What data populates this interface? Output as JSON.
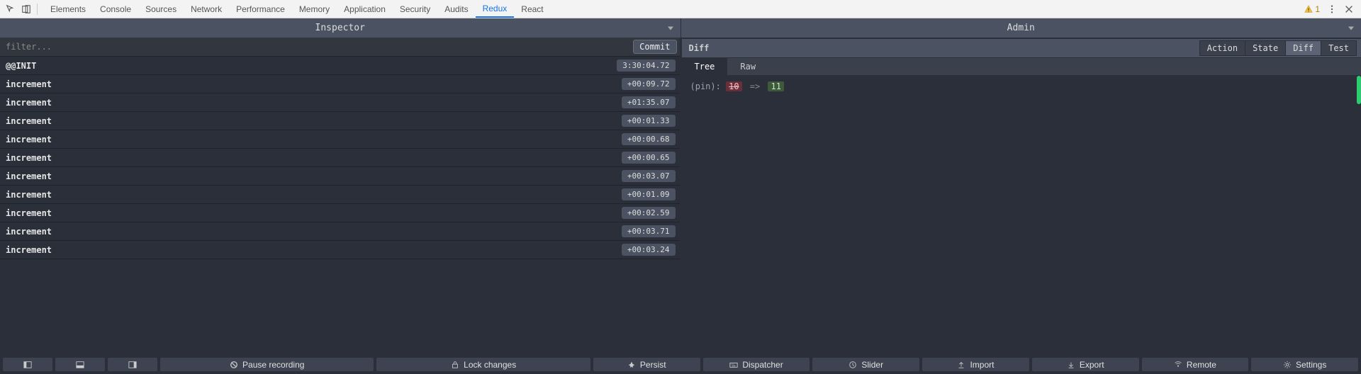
{
  "devtools": {
    "tabs": [
      "Elements",
      "Console",
      "Sources",
      "Network",
      "Performance",
      "Memory",
      "Application",
      "Security",
      "Audits",
      "Redux",
      "React"
    ],
    "active_tab": "Redux",
    "warnings": "1"
  },
  "panel_headers": {
    "left": "Inspector",
    "right": "Admin"
  },
  "filter": {
    "placeholder": "filter...",
    "commit": "Commit"
  },
  "actions": [
    {
      "name": "@@INIT",
      "time": "3:30:04.72"
    },
    {
      "name": "increment",
      "time": "+00:09.72"
    },
    {
      "name": "increment",
      "time": "+01:35.07"
    },
    {
      "name": "increment",
      "time": "+00:01.33"
    },
    {
      "name": "increment",
      "time": "+00:00.68"
    },
    {
      "name": "increment",
      "time": "+00:00.65"
    },
    {
      "name": "increment",
      "time": "+00:03.07"
    },
    {
      "name": "increment",
      "time": "+00:01.09"
    },
    {
      "name": "increment",
      "time": "+00:02.59"
    },
    {
      "name": "increment",
      "time": "+00:03.71"
    },
    {
      "name": "increment",
      "time": "+00:03.24"
    }
  ],
  "admin": {
    "header_title": "Diff",
    "segments": [
      "Action",
      "State",
      "Diff",
      "Test"
    ],
    "active_segment": "Diff",
    "view_tabs": [
      "Tree",
      "Raw"
    ],
    "active_view": "Tree",
    "diff": {
      "key": "(pin):",
      "old": "10",
      "arrow": "=>",
      "new": "11"
    }
  },
  "bottom": {
    "pause": "Pause recording",
    "lock": "Lock changes",
    "persist": "Persist",
    "dispatcher": "Dispatcher",
    "slider": "Slider",
    "import": "Import",
    "export": "Export",
    "remote": "Remote",
    "settings": "Settings"
  }
}
